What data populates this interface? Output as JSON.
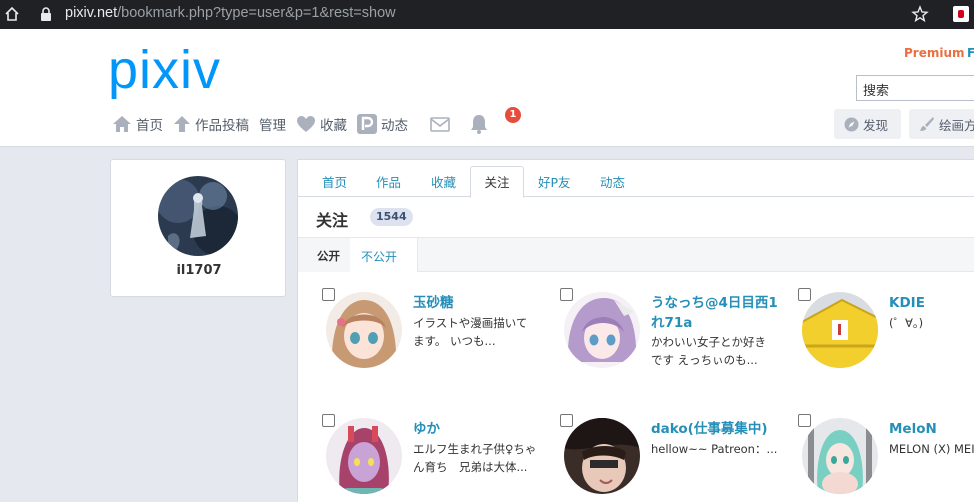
{
  "browser": {
    "url_host": "pixiv.net",
    "url_path": "/bookmark.php?type=user&p=1&rest=show"
  },
  "header": {
    "logo": "pixiv",
    "premium": "Premium",
    "premium_cut": "F",
    "search_placeholder": "搜索",
    "nav": [
      {
        "label": "首页",
        "icon": "home-icon"
      },
      {
        "label": "作品投稿",
        "icon": "upload-icon"
      },
      {
        "label": "管理",
        "icon": ""
      },
      {
        "label": "收藏",
        "icon": "heart-icon"
      },
      {
        "label": "动态",
        "icon": "pixiv-p-icon"
      }
    ],
    "notification_count": "1",
    "discover_button": "发现",
    "paint_button": "绘画方"
  },
  "profile": {
    "username": "il1707"
  },
  "main": {
    "tabs": [
      "首页",
      "作品",
      "收藏",
      "关注",
      "好P友",
      "动态"
    ],
    "active_tab": "关注",
    "title": "关注",
    "count": "1544",
    "subtab_public": "公开",
    "subtab_private": "不公开",
    "users": [
      {
        "name": "玉砂糖",
        "desc1": "イラストや漫画描いて",
        "desc2": "ます。 いつも..."
      },
      {
        "name": "うなっち@4日目西1",
        "name2": "れ71a",
        "desc1": "かわいい女子とか好き",
        "desc2": "です えっちぃのも..."
      },
      {
        "name": "KDIE",
        "desc1": "(゜∀。)",
        "desc2": ""
      },
      {
        "name": "ゆか",
        "desc1": "エルフ生まれ子供♀ちゃ",
        "desc2": "ん育ち　兄弟は大体..."
      },
      {
        "name": "dako(仕事募集中)",
        "desc1": "hellow~~ Patreon：...",
        "desc2": ""
      },
      {
        "name": "MeloN",
        "desc1": "MELON (X) MEI",
        "desc2": ""
      }
    ]
  },
  "colors": {
    "link": "#258fb8",
    "brand": "#0096fa",
    "premium": "#e96f3e",
    "badge": "#e74c3c"
  }
}
